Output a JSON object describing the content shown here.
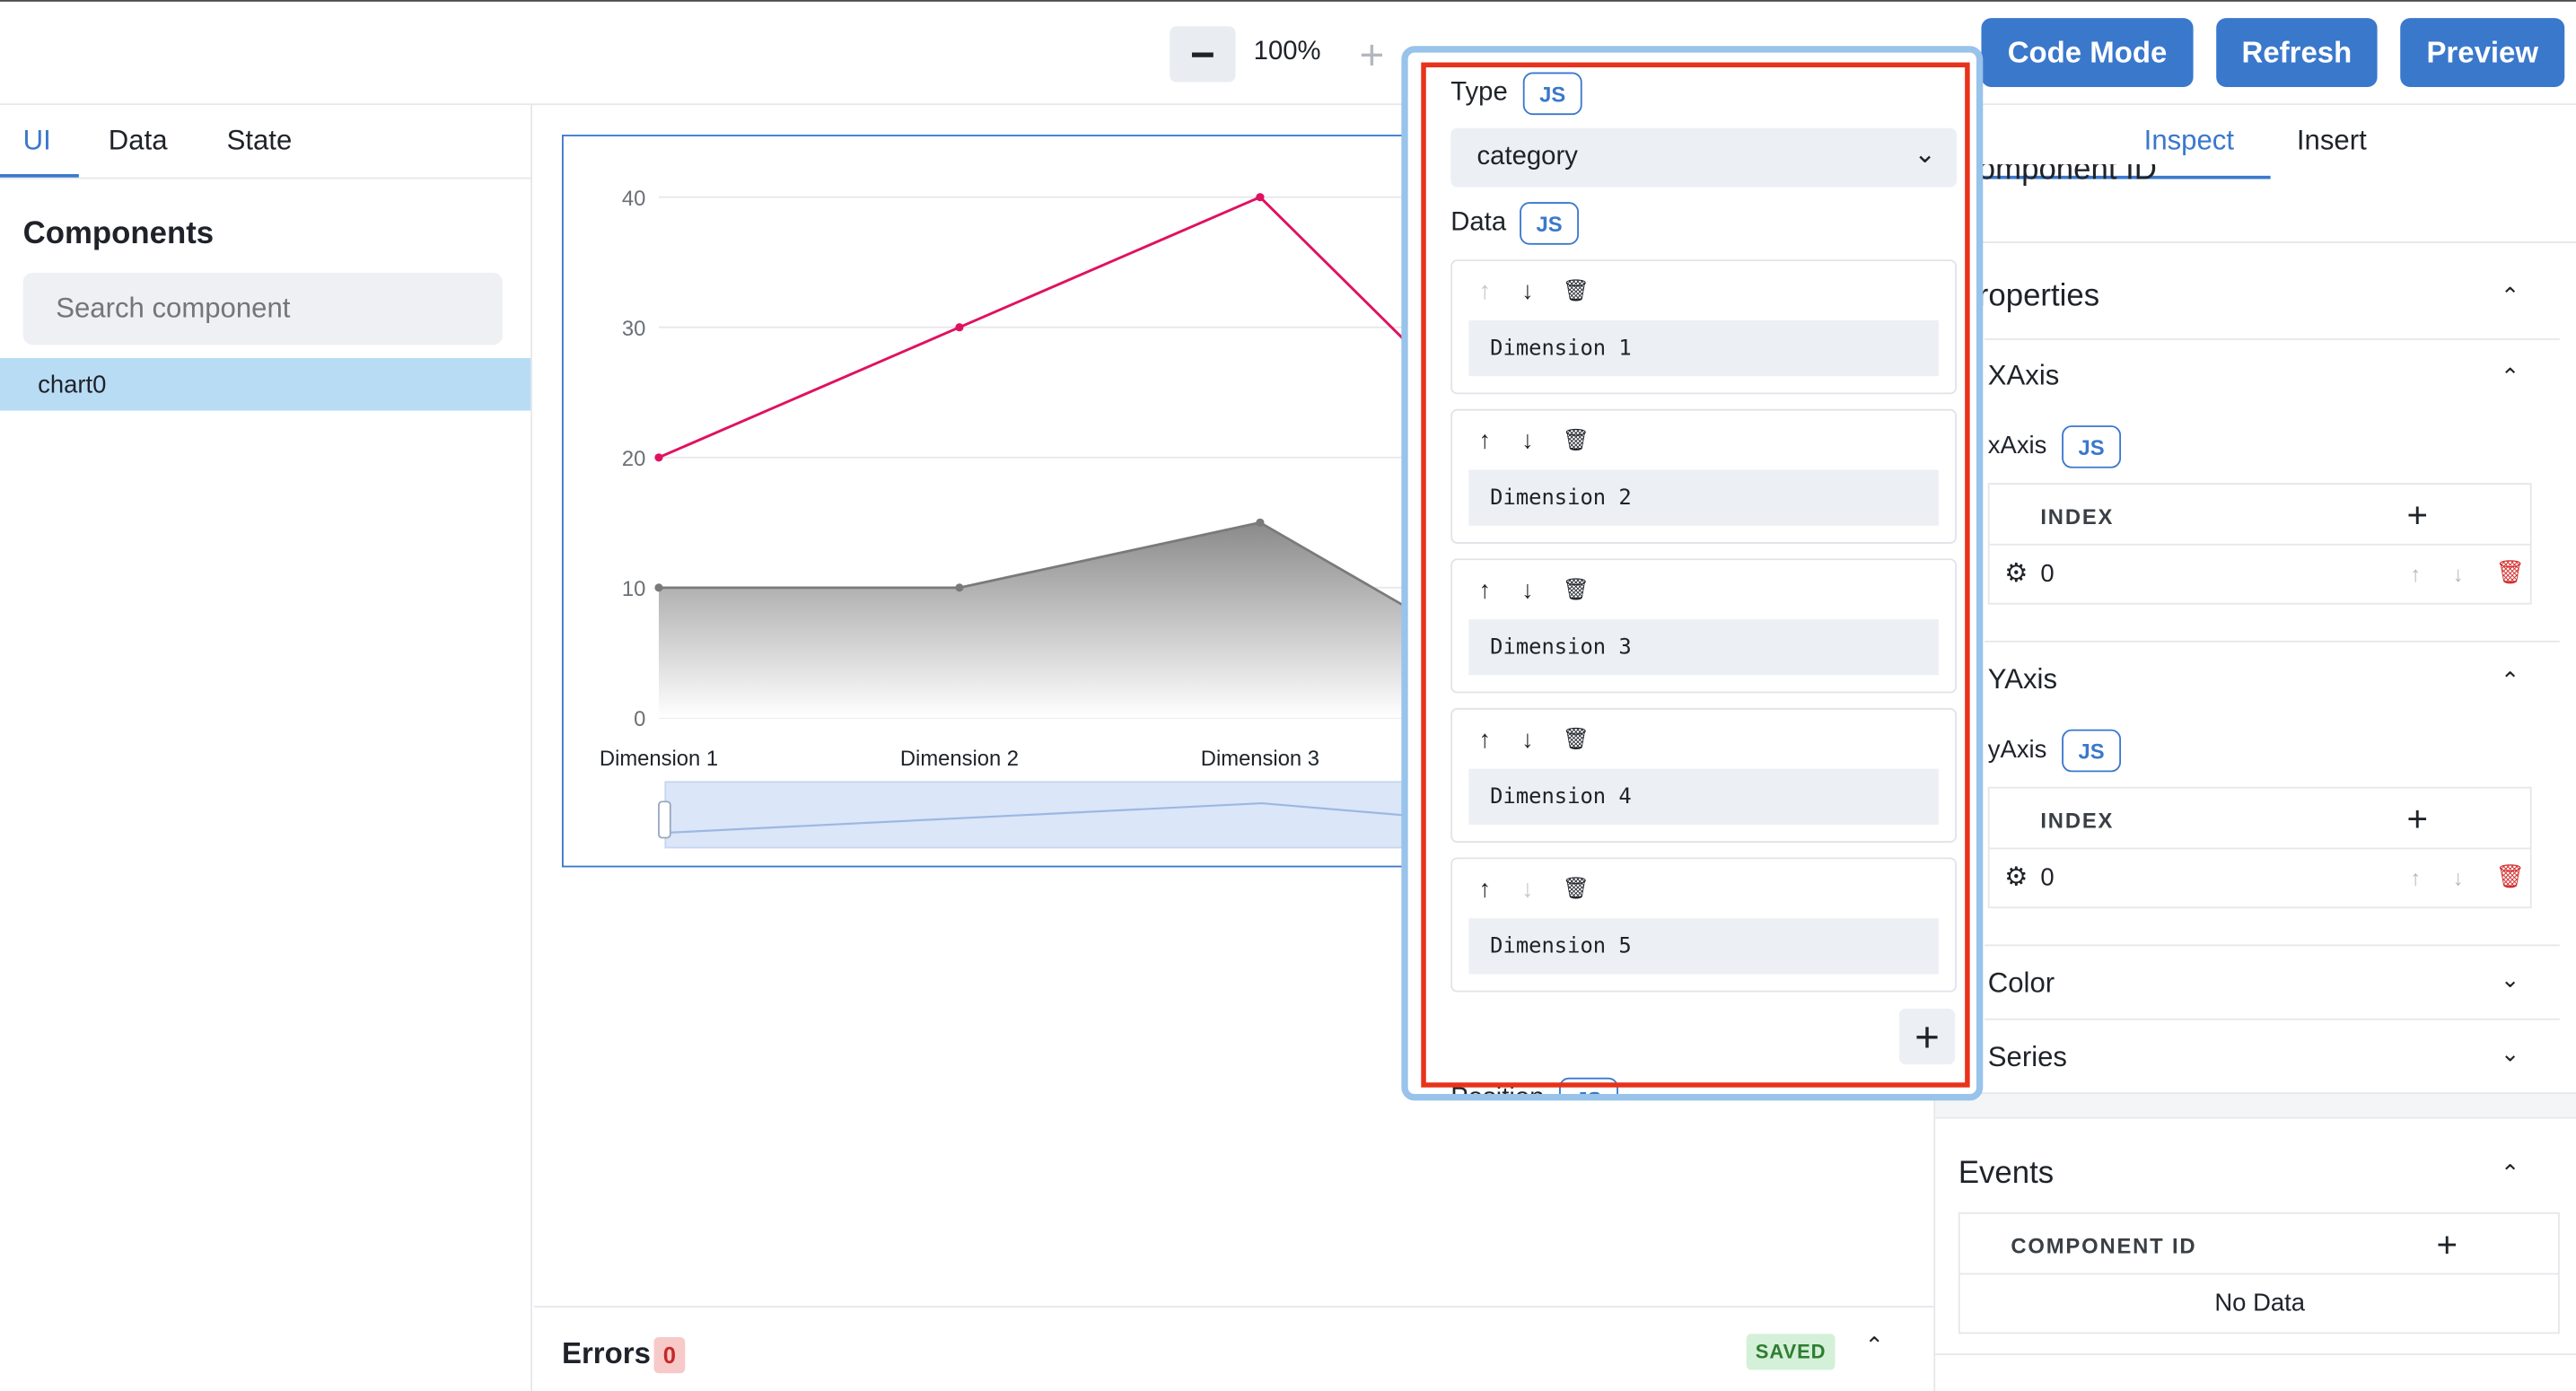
{
  "toolbar": {
    "zoom_level": "100%",
    "code_mode": "Code Mode",
    "refresh": "Refresh",
    "preview": "Preview"
  },
  "left_panel": {
    "tabs": [
      "UI",
      "Data",
      "State"
    ],
    "components_title": "Components",
    "search_placeholder": "Search component",
    "items": [
      "chart0"
    ]
  },
  "chart_data": {
    "type": "line",
    "categories": [
      "Dimension 1",
      "Dimension 2",
      "Dimension 3"
    ],
    "series": [
      {
        "values": [
          20,
          30,
          40
        ],
        "color": "#e0115f"
      },
      {
        "values": [
          10,
          10,
          15
        ],
        "color": "#7a7a7a",
        "area": true
      }
    ],
    "yticks": [
      "0",
      "10",
      "20",
      "30",
      "40"
    ],
    "ylim": [
      0,
      40
    ]
  },
  "bottom_bar": {
    "errors_label": "Errors",
    "errors_count": "0",
    "saved_label": "SAVED"
  },
  "right_panel": {
    "tabs": [
      "Inspect",
      "Insert"
    ],
    "component_id_partial": "omponent ID",
    "properties_title": "roperties",
    "xaxis": {
      "title": "XAxis",
      "label": "xAxis",
      "js": "JS",
      "col": "INDEX",
      "row": "0"
    },
    "yaxis": {
      "title": "YAxis",
      "label": "yAxis",
      "js": "JS",
      "col": "INDEX",
      "row": "0"
    },
    "color_title": "Color",
    "series_title": "Series",
    "events_title": "Events",
    "events_col": "COMPONENT ID",
    "events_empty": "No Data"
  },
  "popover": {
    "type_label": "Type",
    "type_js": "JS",
    "type_value": "category",
    "data_label": "Data",
    "data_js": "JS",
    "items": [
      "Dimension 1",
      "Dimension 2",
      "Dimension 3",
      "Dimension 4",
      "Dimension 5"
    ],
    "position_label": "Position",
    "position_js": "JS"
  },
  "colors": {
    "accent": "#3a78cc",
    "highlight_frame": "#e8321b",
    "selected_item": "#b9dcf5"
  }
}
